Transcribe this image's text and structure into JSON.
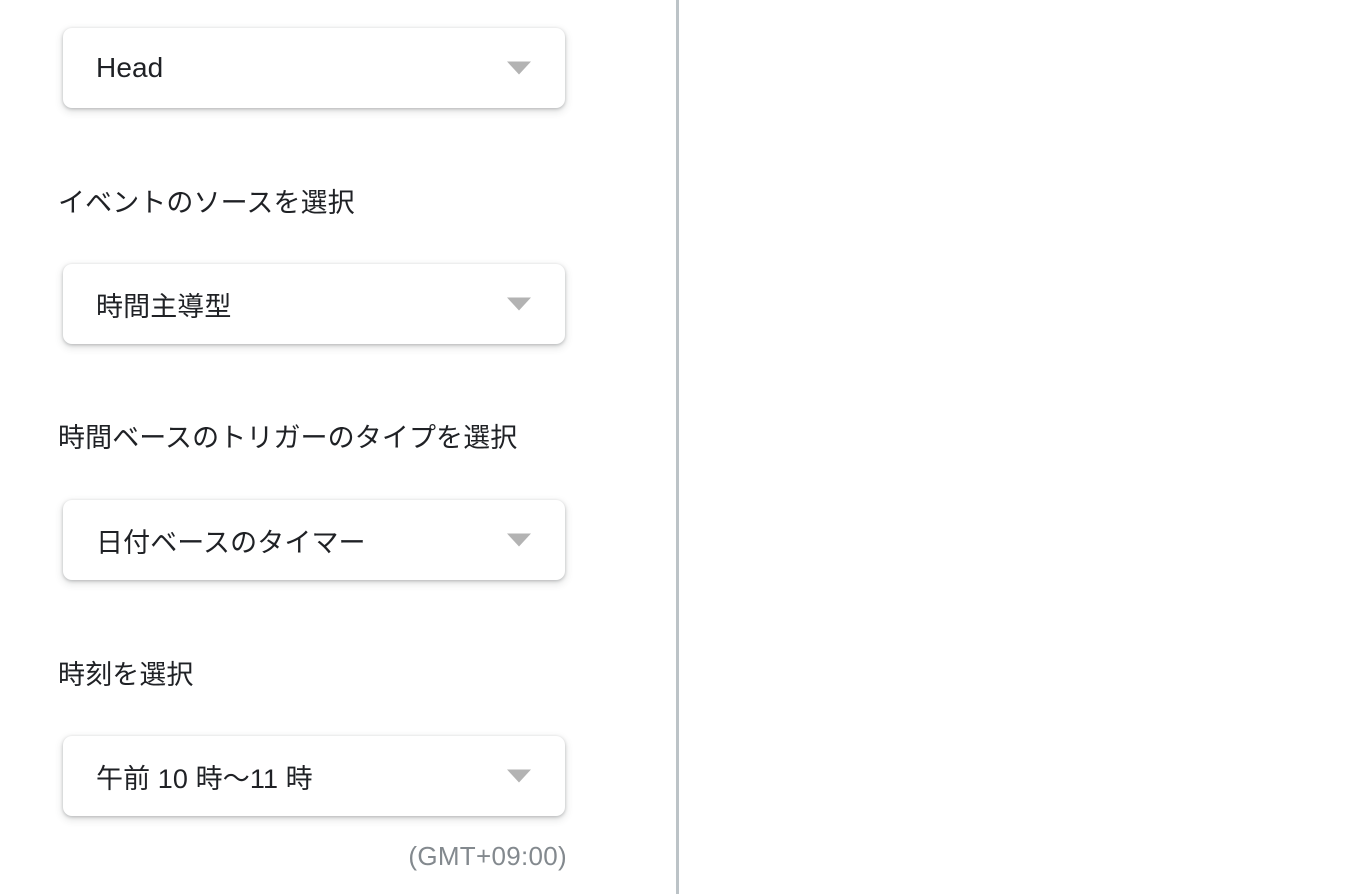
{
  "layout": {
    "divider_color": "#bcc3c7",
    "background": "#ffffff",
    "text_color": "#1f2125",
    "helper_color": "#83898e",
    "caret_color": "#b3b3b3"
  },
  "left_pane": {
    "fields": [
      {
        "id": "head",
        "label": "",
        "value": "Head",
        "caret": "chevron-down-icon"
      },
      {
        "id": "event_source",
        "label": "イベントのソースを選択",
        "value": "時間主導型",
        "caret": "chevron-down-icon"
      },
      {
        "id": "trigger_type",
        "label": "時間ベースのトリガーのタイプを選択",
        "value": "日付ベースのタイマー",
        "caret": "chevron-down-icon"
      },
      {
        "id": "time_of_day",
        "label": "時刻を選択",
        "value": "午前 10 時〜11 時",
        "caret": "chevron-down-icon",
        "helper": "(GMT+09:00)"
      }
    ]
  },
  "right_pane": {
    "content": ""
  }
}
